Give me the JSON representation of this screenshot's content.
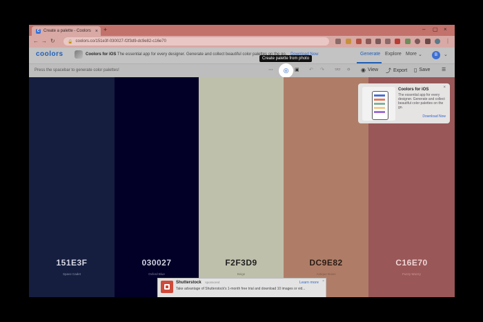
{
  "browser": {
    "tab_title": "Create a palette - Coolors",
    "tab_close": "×",
    "new_tab": "+",
    "url": "coolors.co/151e3f-030027-f2f3d9-dc9e82-c16e70",
    "window_controls": [
      "–",
      "▢",
      "×"
    ]
  },
  "header": {
    "logo": "coolors",
    "promo_title": "Coolors for iOS",
    "promo_text": "The essential app for every designer. Generate and collect beautiful color palettes on the go.",
    "promo_link": "Download Now",
    "nav": [
      "Generate",
      "Explore",
      "More"
    ],
    "avatar": "B"
  },
  "toolbar": {
    "hint": "Press the spacebar to generate color palettes!",
    "tooltip": "Create palette from photo",
    "view": "View",
    "export": "Export",
    "save": "Save"
  },
  "palette": [
    {
      "hex": "151E3F",
      "name": "Space Cadet",
      "color": "#151e3f",
      "text": "#d8d8e6",
      "sub": "#8f93ab"
    },
    {
      "hex": "030027",
      "name": "Oxford Blue",
      "color": "#030027",
      "text": "#d0d0e0",
      "sub": "#7f7fa0"
    },
    {
      "hex": "F2F3D9",
      "name": "Beige",
      "color": "#bfc0ab",
      "text": "#1f1f1f",
      "sub": "#6f7060"
    },
    {
      "hex": "DC9E82",
      "name": "Antique Brass",
      "color": "#af7d67",
      "text": "#2a1c16",
      "sub": "#7d5846"
    },
    {
      "hex": "C16E70",
      "name": "Fuzzy Wuzzy",
      "color": "#995758",
      "text": "#f0d5d5",
      "sub": "#d09a9b"
    }
  ],
  "ios_card": {
    "title": "Coolors for iOS",
    "text": "The essential app for every designer. Generate and collect beautiful color palettes on the go.",
    "link": "Download Now",
    "close": "×"
  },
  "ad": {
    "brand": "Shutterstock",
    "tag": "sponsored",
    "text": "Take advantage of Shutterstock's 1-month free trial and download 10 images or vid...",
    "link": "Learn more",
    "close": "×"
  }
}
